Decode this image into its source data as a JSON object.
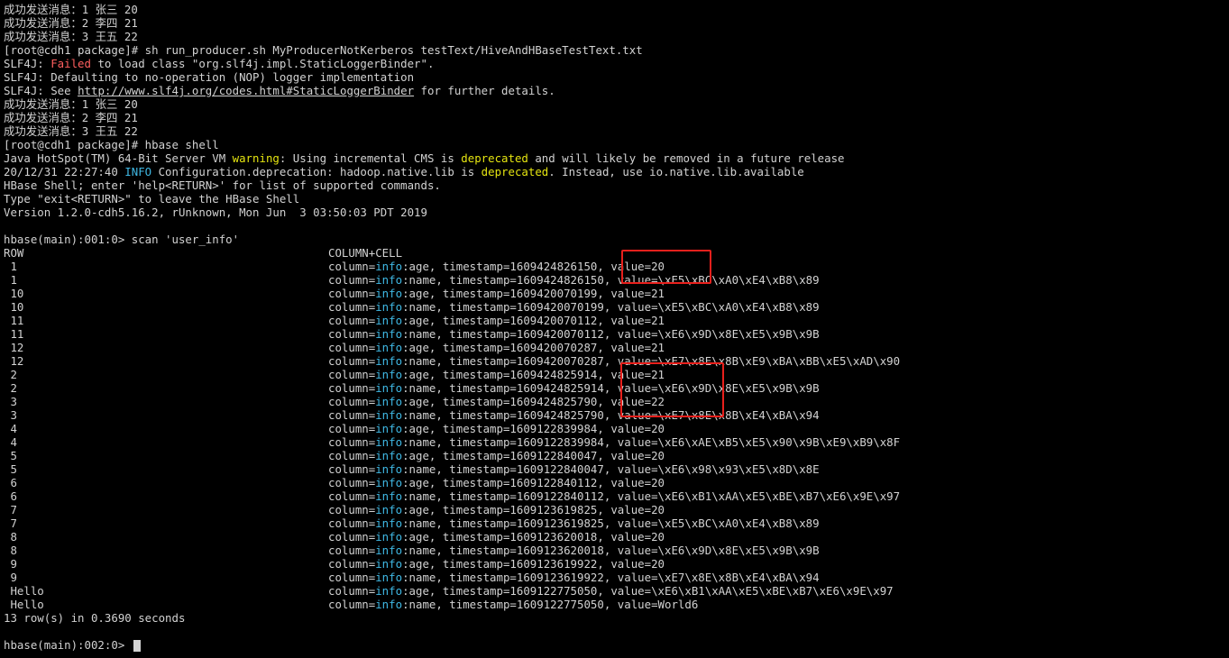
{
  "terminal": {
    "pre_lines": [
      "成功发送消息：1 张三 20",
      "成功发送消息：2 李四 21",
      "成功发送消息：3 王五 22"
    ],
    "command1": "[root@cdh1 package]# sh run_producer.sh MyProducerNotKerberos testText/HiveAndHBaseTestText.txt",
    "slf4j": {
      "prefix": "SLF4J: ",
      "failed": "Failed",
      "failed_rest": " to load class \"org.slf4j.impl.StaticLoggerBinder\".",
      "defaulting": "SLF4J: Defaulting to no-operation (NOP) logger implementation",
      "see": "SLF4J: See ",
      "url": "http://www.slf4j.org/codes.html#StaticLoggerBinder",
      "see_rest": " for further details."
    },
    "sent_lines": [
      "成功发送消息：1 张三 20",
      "成功发送消息：2 李四 21",
      "成功发送消息：3 王五 22"
    ],
    "command2": "[root@cdh1 package]# hbase shell",
    "java_warning": {
      "prefix": "Java HotSpot(TM) 64-Bit Server VM ",
      "warning": "warning",
      "middle": ": Using incremental CMS is ",
      "deprecated": "deprecated",
      "rest": " and will likely be removed in a future release"
    },
    "info_line": {
      "prefix": "20/12/31 22:27:40 ",
      "info": "INFO",
      "middle": " Configuration.deprecation: hadoop.native.lib is ",
      "deprecated": "deprecated",
      "rest": ". Instead, use io.native.lib.available"
    },
    "hbase_intro": [
      "HBase Shell; enter 'help<RETURN>' for list of supported commands.",
      "Type \"exit<RETURN>\" to leave the HBase Shell",
      "Version 1.2.0-cdh5.16.2, rUnknown, Mon Jun  3 03:50:03 PDT 2019"
    ],
    "scan_command": "hbase(main):001:0> scan 'user_info'",
    "scan_header": {
      "row": "ROW",
      "cell": "COLUMN+CELL"
    },
    "column_prefix": "column=",
    "family": "info",
    "scan_rows": [
      {
        "row": " 1",
        "qualifier": ":age, timestamp=1609424826150, value=20"
      },
      {
        "row": " 1",
        "qualifier": ":name, timestamp=1609424826150, value=\\xE5\\xBC\\xA0\\xE4\\xB8\\x89"
      },
      {
        "row": " 10",
        "qualifier": ":age, timestamp=1609420070199, value=21"
      },
      {
        "row": " 10",
        "qualifier": ":name, timestamp=1609420070199, value=\\xE5\\xBC\\xA0\\xE4\\xB8\\x89"
      },
      {
        "row": " 11",
        "qualifier": ":age, timestamp=1609420070112, value=21"
      },
      {
        "row": " 11",
        "qualifier": ":name, timestamp=1609420070112, value=\\xE6\\x9D\\x8E\\xE5\\x9B\\x9B"
      },
      {
        "row": " 12",
        "qualifier": ":age, timestamp=1609420070287, value=21"
      },
      {
        "row": " 12",
        "qualifier": ":name, timestamp=1609420070287, value=\\xE7\\x8E\\x8B\\xE9\\xBA\\xBB\\xE5\\xAD\\x90"
      },
      {
        "row": " 2",
        "qualifier": ":age, timestamp=1609424825914, value=21"
      },
      {
        "row": " 2",
        "qualifier": ":name, timestamp=1609424825914, value=\\xE6\\x9D\\x8E\\xE5\\x9B\\x9B"
      },
      {
        "row": " 3",
        "qualifier": ":age, timestamp=1609424825790, value=22"
      },
      {
        "row": " 3",
        "qualifier": ":name, timestamp=1609424825790, value=\\xE7\\x8E\\x8B\\xE4\\xBA\\x94"
      },
      {
        "row": " 4",
        "qualifier": ":age, timestamp=1609122839984, value=20"
      },
      {
        "row": " 4",
        "qualifier": ":name, timestamp=1609122839984, value=\\xE6\\xAE\\xB5\\xE5\\x90\\x9B\\xE9\\xB9\\x8F"
      },
      {
        "row": " 5",
        "qualifier": ":age, timestamp=1609122840047, value=20"
      },
      {
        "row": " 5",
        "qualifier": ":name, timestamp=1609122840047, value=\\xE6\\x98\\x93\\xE5\\x8D\\x8E"
      },
      {
        "row": " 6",
        "qualifier": ":age, timestamp=1609122840112, value=20"
      },
      {
        "row": " 6",
        "qualifier": ":name, timestamp=1609122840112, value=\\xE6\\xB1\\xAA\\xE5\\xBE\\xB7\\xE6\\x9E\\x97"
      },
      {
        "row": " 7",
        "qualifier": ":age, timestamp=1609123619825, value=20"
      },
      {
        "row": " 7",
        "qualifier": ":name, timestamp=1609123619825, value=\\xE5\\xBC\\xA0\\xE4\\xB8\\x89"
      },
      {
        "row": " 8",
        "qualifier": ":age, timestamp=1609123620018, value=20"
      },
      {
        "row": " 8",
        "qualifier": ":name, timestamp=1609123620018, value=\\xE6\\x9D\\x8E\\xE5\\x9B\\x9B"
      },
      {
        "row": " 9",
        "qualifier": ":age, timestamp=1609123619922, value=20"
      },
      {
        "row": " 9",
        "qualifier": ":name, timestamp=1609123619922, value=\\xE7\\x8E\\x8B\\xE4\\xBA\\x94"
      },
      {
        "row": " Hello",
        "qualifier": ":age, timestamp=1609122775050, value=\\xE6\\xB1\\xAA\\xE5\\xBE\\xB7\\xE6\\x9E\\x97"
      },
      {
        "row": " Hello",
        "qualifier": ":name, timestamp=1609122775050, value=World6"
      }
    ],
    "summary": "13 row(s) in 0.3690 seconds",
    "prompt": "hbase(main):002:0> "
  },
  "colors": {
    "background": "#000000",
    "text": "#d2d2d2",
    "error": "#ff5f5f",
    "warning": "#e5e510",
    "info": "#3fb8e4",
    "annotation_box": "#e8201c"
  }
}
